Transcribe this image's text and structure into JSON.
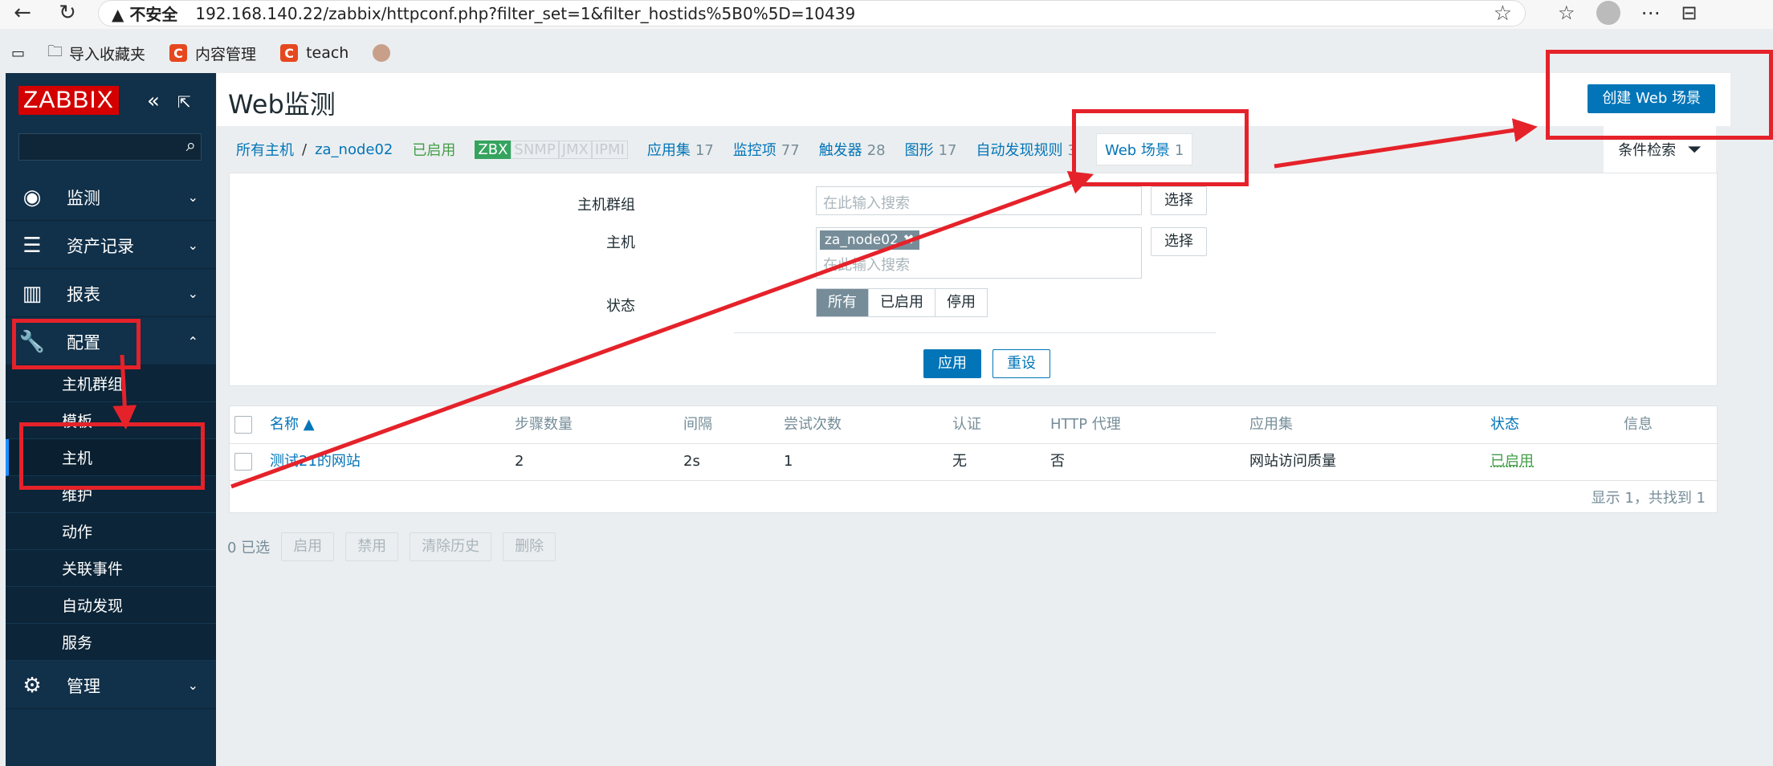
{
  "browser": {
    "insecure_label": "不安全",
    "url": "192.168.140.22/zabbix/httpconf.php?filter_set=1&filter_hostids%5B0%5D=10439",
    "bookmarks": [
      "导入收藏夹",
      "内容管理",
      "teach"
    ]
  },
  "sidebar": {
    "logo": "ZABBIX",
    "search_value": "",
    "menu": [
      {
        "label": "监测"
      },
      {
        "label": "资产记录"
      },
      {
        "label": "报表"
      },
      {
        "label": "配置"
      },
      {
        "label": "管理"
      }
    ],
    "submenu": [
      "主机群组",
      "模板",
      "主机",
      "维护",
      "动作",
      "关联事件",
      "自动发现",
      "服务"
    ]
  },
  "header": {
    "title": "Web监测",
    "create_button": "创建 Web 场景"
  },
  "breadcrumbs": {
    "all_hosts": "所有主机",
    "separator": "/",
    "host": "za_node02",
    "status": "已启用",
    "interfaces": [
      "ZBX",
      "SNMP",
      "JMX",
      "IPMI"
    ],
    "tabs": [
      {
        "label": "应用集",
        "count": "17"
      },
      {
        "label": "监控项",
        "count": "77"
      },
      {
        "label": "触发器",
        "count": "28"
      },
      {
        "label": "图形",
        "count": "17"
      },
      {
        "label": "自动发现规则",
        "count": "3"
      },
      {
        "label": "Web 场景",
        "count": "1"
      }
    ]
  },
  "filter": {
    "toggle_label": "条件检索",
    "host_group_label": "主机群组",
    "host_label": "主机",
    "status_label": "状态",
    "placeholder": "在此输入搜索",
    "select_button": "选择",
    "host_chip": "za_node02",
    "status_options": [
      "所有",
      "已启用",
      "停用"
    ],
    "selected_status": "所有",
    "apply": "应用",
    "reset": "重设"
  },
  "table": {
    "columns": [
      "名称 ▲",
      "步骤数量",
      "间隔",
      "尝试次数",
      "认证",
      "HTTP 代理",
      "应用集",
      "状态",
      "信息"
    ],
    "rows": [
      {
        "name": "测试21的网站",
        "steps": "2",
        "interval": "2s",
        "attempts": "1",
        "auth": "无",
        "http_proxy": "否",
        "application": "网站访问质量",
        "status": "已启用",
        "info": ""
      }
    ],
    "footer": "显示 1，共找到 1"
  },
  "bulk_actions": {
    "selected": "0 已选",
    "buttons": [
      "启用",
      "禁用",
      "清除历史",
      "删除"
    ]
  },
  "colors": {
    "sidebar_bg": "#113049",
    "primary": "#0275b8",
    "annotation": "#e5222a",
    "enabled_green": "#429e47"
  }
}
